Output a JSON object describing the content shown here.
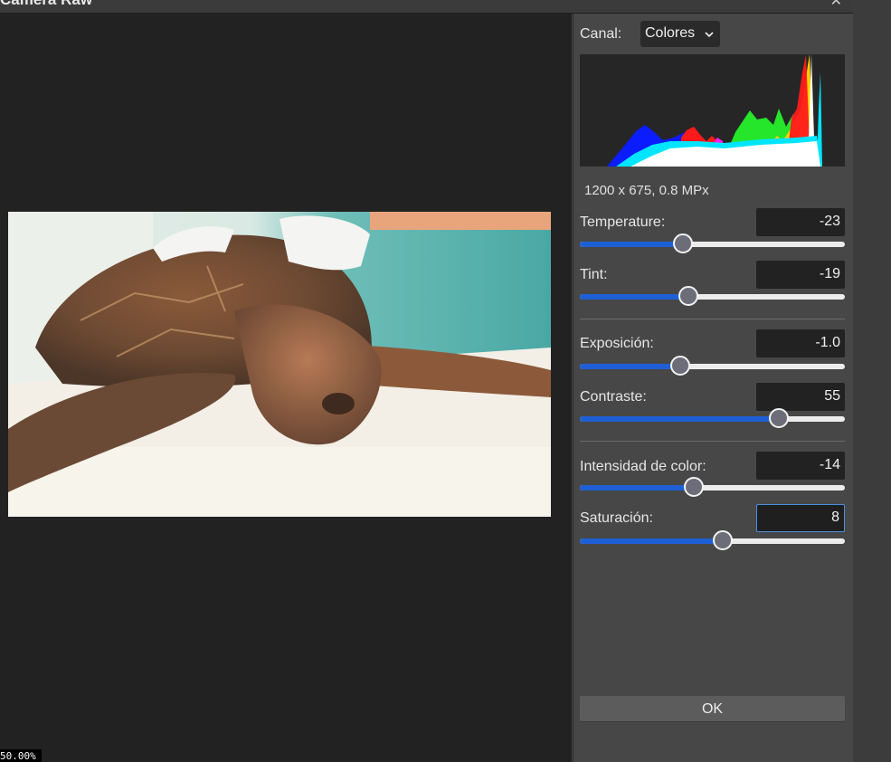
{
  "dialog": {
    "title": "Camera Raw"
  },
  "preview": {
    "zoom": "50.00%"
  },
  "channel": {
    "label": "Canal:",
    "value": "Colores"
  },
  "image_info": "1200 x 675, 0.8 MPx",
  "sliders": [
    {
      "label": "Temperature:",
      "value": "-23",
      "level": 0.39
    },
    {
      "label": "Tint:",
      "value": "-19",
      "level": 0.41
    },
    {
      "label": "Exposición:",
      "value": "-1.0",
      "level": 0.38
    },
    {
      "label": "Contraste:",
      "value": "55",
      "level": 0.75
    },
    {
      "label": "Intensidad de color:",
      "value": "-14",
      "level": 0.43
    },
    {
      "label": "Saturación:",
      "value": "8",
      "level": 0.54
    }
  ],
  "ok_label": "OK",
  "colors": {
    "accent": "#1f5fd6",
    "focus": "#4a8ede"
  }
}
